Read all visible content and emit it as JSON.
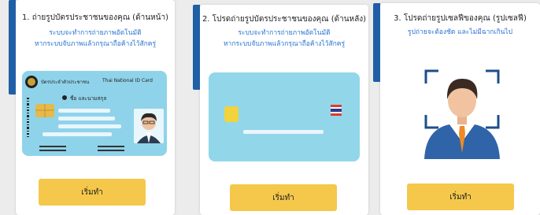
{
  "steps": [
    {
      "title": "1. ถ่ายรูปบัตรประชาชนของคุณ (ด้านหน้า)",
      "subtitle_1": "ระบบจะทำการถ่ายภาพอัตโนมัติ",
      "subtitle_2": "หากระบบจับภาพแล้วกรุณาถือค้างไว้สักครู่",
      "button": "เริ่มทำ"
    },
    {
      "title": "2. โปรดถ่ายรูปบัตรประชาชนของคุณ (ด้านหลัง)",
      "subtitle_1": "ระบบจะทำการถ่ายภาพอัตโนมัติ",
      "subtitle_2": "หากระบบจับภาพแล้วกรุณาถือค้างไว้สักครู่",
      "button": "เริ่มทำ"
    },
    {
      "title": "3. โปรดถ่ายรูปเซลฟีของคุณ (รูปเซลฟี)",
      "subtitle_1": "รูปถ่ายจะต้องชัด และไม่มีฉากเกินไป",
      "button": "เริ่มทำ"
    }
  ],
  "id_card": {
    "header_th": "บัตรประจำตัวประชาชน",
    "header_en": "Thai National ID Card",
    "name_label": "ชื่อ และนามสกุล"
  },
  "colors": {
    "accent": "#1f5fa6",
    "button": "#f5c84b",
    "subtitle": "#2a74d4",
    "card": "#8fd3ea",
    "card_back": "#92d6ea"
  }
}
